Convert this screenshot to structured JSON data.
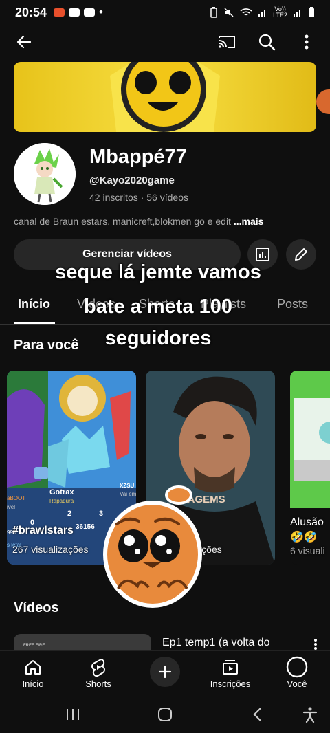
{
  "status_bar": {
    "time": "20:54",
    "dot": "•",
    "lte_top": "Vo))",
    "lte_bottom": "LTE2"
  },
  "icons": {
    "back": "back-arrow-icon",
    "cast": "cast-icon",
    "search": "search-icon",
    "more": "more-vert-icon"
  },
  "channel": {
    "name": "Mbappé77",
    "handle": "@Kayo2020game",
    "subscribers": "42 inscritos",
    "separator": "·",
    "videos": "56 vídeos",
    "description": "canal de Braun estars, manicreft,blokmen go e edit",
    "more_label": "...mais"
  },
  "actions": {
    "manage_videos": "Gerenciar vídeos"
  },
  "tabs": [
    {
      "label": "Início",
      "active": true
    },
    {
      "label": "Vídeos",
      "active": false
    },
    {
      "label": "Shorts",
      "active": false
    },
    {
      "label": "Playlists",
      "active": false
    },
    {
      "label": "Posts",
      "active": false
    }
  ],
  "overlay_caption": {
    "line1": "seque lá jemte vamos",
    "line2": "bate a meta 100",
    "line3": "seguidores"
  },
  "for_you": {
    "title": "Para você",
    "cards": [
      {
        "title": "#brawlstars",
        "views": "267 visualizações",
        "game_labels": {
          "name": "Gotrax",
          "role": "Rapadura",
          "count_a": "2",
          "count_b": "3",
          "score": "36156",
          "left_tag": "aBOOT",
          "left_sub": "ivel",
          "right_tag": "XZSU",
          "right_sub": "Vai em",
          "zero": "0",
          "left_bottom": "s letal",
          "left_num": "997"
        }
      },
      {
        "title": "A",
        "views": "14 visualizações",
        "image_text": "IMAGEMS"
      },
      {
        "title": "Alusão",
        "emoji": "🤣🤣",
        "views": "6 visuali"
      }
    ]
  },
  "videos_section": {
    "title": "Vídeos",
    "first_video_title": "Ep1 temp1 (a volta do",
    "thumb_text": "FREE FIRE"
  },
  "bottom_nav": {
    "home": "Início",
    "shorts": "Shorts",
    "subscriptions": "Inscrições",
    "you": "Você"
  },
  "colors": {
    "background": "#0f0f0f",
    "button_bg": "#272727",
    "muted_text": "#aaaaaa",
    "banner_yellow": "#f4d93a"
  }
}
